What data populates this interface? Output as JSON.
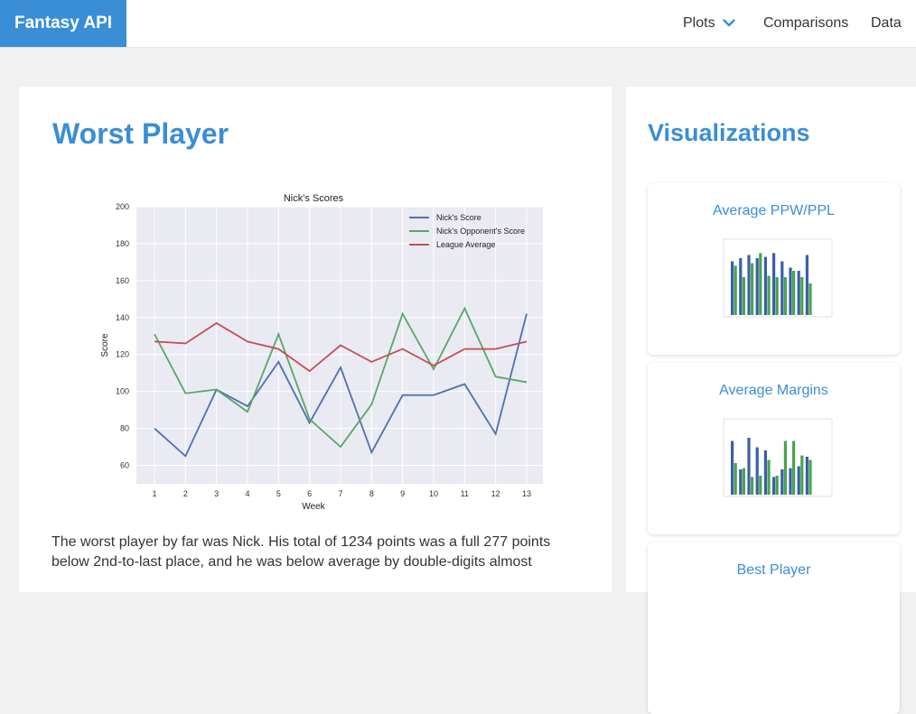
{
  "nav": {
    "brand": "Fantasy API",
    "items": [
      "Plots",
      "Comparisons",
      "Data"
    ]
  },
  "main": {
    "title": "Worst Player",
    "text": "The worst player by far was Nick. His total of 1234 points was a full 277 points below 2nd-to-last place, and he was below average by double-digits almost"
  },
  "chart_data": {
    "type": "line",
    "title": "Nick's Scores",
    "xlabel": "Week",
    "ylabel": "Score",
    "x": [
      1,
      2,
      3,
      4,
      5,
      6,
      7,
      8,
      9,
      10,
      11,
      12,
      13
    ],
    "ylim": [
      50,
      200
    ],
    "yticks": [
      60,
      80,
      100,
      120,
      140,
      160,
      180,
      200
    ],
    "grid": true,
    "legend_position": "top-right",
    "series": [
      {
        "name": "Nick's Score",
        "color": "#4c72b0",
        "values": [
          80,
          65,
          101,
          92,
          116,
          83,
          113,
          67,
          98,
          98,
          104,
          77,
          142
        ]
      },
      {
        "name": "Nick's Opponent's Score",
        "color": "#55a868",
        "values": [
          131,
          99,
          101,
          89,
          131,
          85,
          70,
          93,
          142,
          112,
          145,
          108,
          105
        ]
      },
      {
        "name": "League Average",
        "color": "#c44e52",
        "values": [
          127,
          126,
          137,
          127,
          123,
          111,
          125,
          116,
          123,
          114,
          123,
          123,
          127
        ]
      }
    ]
  },
  "sidebar": {
    "title": "Visualizations",
    "cards": [
      {
        "label": "Average PPW/PPL"
      },
      {
        "label": "Average Margins"
      },
      {
        "label": "Best Player"
      }
    ]
  }
}
